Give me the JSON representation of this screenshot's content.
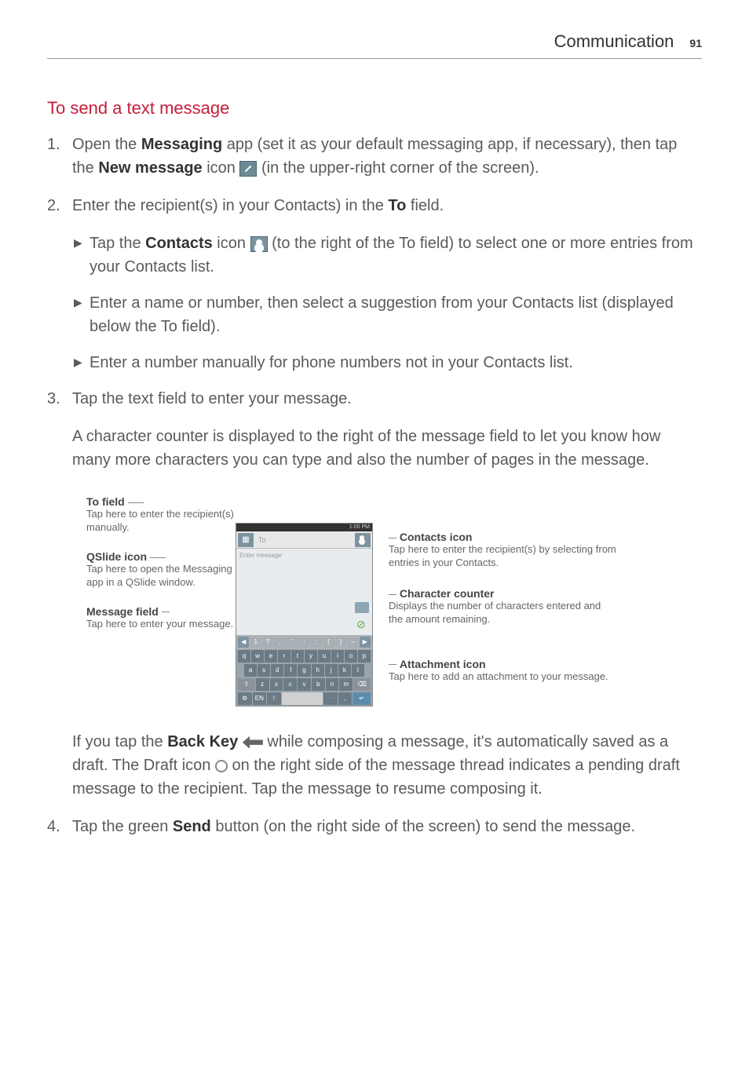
{
  "header": {
    "section": "Communication",
    "page": "91"
  },
  "title": "To send a text message",
  "steps": {
    "s1": {
      "num": "1.",
      "text_a": "Open the ",
      "bold_a": "Messaging",
      "text_b": " app (set it as your default messaging app, if necessary), then tap the ",
      "bold_b": "New message",
      "text_c": " icon ",
      "text_d": " (in the upper-right corner of the screen)."
    },
    "s2": {
      "num": "2.",
      "text_a": "Enter the recipient(s) in your Contacts) in the ",
      "bold_a": "To",
      "text_b": " field.",
      "b1": {
        "text_a": "Tap the ",
        "bold_a": "Contacts",
        "text_b": " icon ",
        "text_c": " (to the right of the To field) to select one or more entries from your Contacts list."
      },
      "b2": "Enter a name or number, then select a suggestion from your Contacts list (displayed below the To field).",
      "b3": "Enter a number manually for phone numbers not in your Contacts list."
    },
    "s3": {
      "num": "3.",
      "text": "Tap the text field to enter your message.",
      "para": "A character counter is displayed to the right of the message field to let you know how many more characters you can type and also the number of pages in the message."
    },
    "s4": {
      "num": "4.",
      "text_a": "Tap the green ",
      "bold_a": "Send",
      "text_b": " button (on the right side of the screen) to send the message."
    }
  },
  "figure": {
    "left": {
      "l1": {
        "title": "To field",
        "desc": "Tap here to enter the recipient(s) manually."
      },
      "l2": {
        "title": "QSlide icon",
        "desc": "Tap here to open the Messaging app in a QSlide window."
      },
      "l3": {
        "title": "Message field",
        "desc": "Tap here to enter your message."
      }
    },
    "right": {
      "r1": {
        "title": "Contacts icon",
        "desc": "Tap here to enter the recipient(s) by selecting from entries in your Contacts."
      },
      "r2": {
        "title": "Character counter",
        "desc": "Displays the number of characters entered and the amount remaining."
      },
      "r3": {
        "title": "Attachment icon",
        "desc": "Tap here to add an attachment to your message."
      }
    },
    "screen": {
      "status": "1:00 PM",
      "to_label": "To",
      "msg_placeholder": "Enter message",
      "nums": [
        "◀",
        "1",
        "?",
        ",",
        "'",
        ":",
        ";",
        "(",
        ")",
        "–",
        "▶"
      ],
      "row1": [
        "q",
        "w",
        "e",
        "r",
        "t",
        "y",
        "u",
        "i",
        "o",
        "p"
      ],
      "row2": [
        "a",
        "s",
        "d",
        "f",
        "g",
        "h",
        "j",
        "k",
        "l"
      ],
      "row3": [
        "⇧",
        "z",
        "x",
        "c",
        "v",
        "b",
        "n",
        "m",
        "⌫"
      ],
      "row4": [
        "⚙",
        "EN",
        "!",
        "",
        "·",
        ",",
        "↵"
      ]
    }
  },
  "after_figure": {
    "text_a": "If you tap the ",
    "bold_a": "Back Key",
    "text_b": " while composing a message, it's automatically saved as a draft. The Draft icon ",
    "text_c": " on the right side of the message thread indicates a pending draft message to the recipient. Tap the message to resume composing it."
  }
}
